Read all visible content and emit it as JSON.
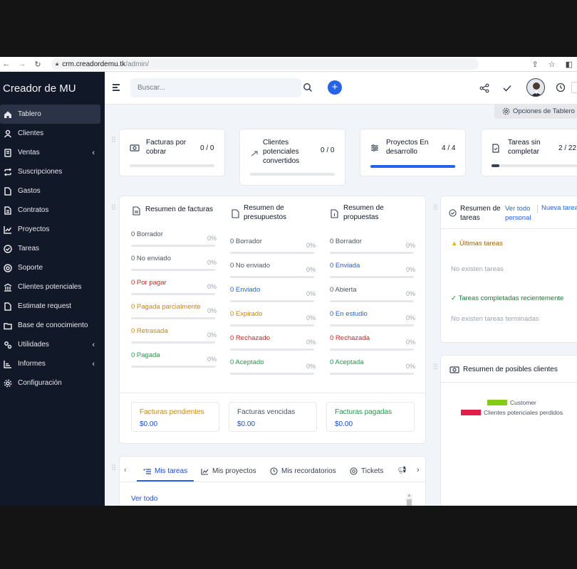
{
  "browser": {
    "url_host": "crm.creadordemu.tk",
    "url_path": "/admin/"
  },
  "sidebar": {
    "brand": "Creador de MU",
    "items": [
      {
        "label": "Tablero",
        "icon": "home-icon",
        "active": true
      },
      {
        "label": "Clientes",
        "icon": "user-icon"
      },
      {
        "label": "Ventas",
        "icon": "receipt-icon",
        "chevron": true
      },
      {
        "label": "Suscripciones",
        "icon": "repeat-icon"
      },
      {
        "label": "Gastos",
        "icon": "document-icon"
      },
      {
        "label": "Contratos",
        "icon": "contract-icon"
      },
      {
        "label": "Proyectos",
        "icon": "chart-icon"
      },
      {
        "label": "Tareas",
        "icon": "check-circle-icon"
      },
      {
        "label": "Soporte",
        "icon": "lifebuoy-icon"
      },
      {
        "label": "Clientes potenciales",
        "icon": "leads-icon"
      },
      {
        "label": "Estimate request",
        "icon": "document-icon"
      },
      {
        "label": "Base de conocimiento",
        "icon": "folder-icon"
      },
      {
        "label": "Utilidades",
        "icon": "gears-icon",
        "chevron": true
      },
      {
        "label": "Informes",
        "icon": "chart-line-icon",
        "chevron": true
      },
      {
        "label": "Configuración",
        "icon": "gear-icon"
      }
    ]
  },
  "topbar": {
    "search_placeholder": "Buscar...",
    "plus": "+"
  },
  "options": {
    "label": "Opciones de Tablero"
  },
  "stats": [
    {
      "title_1": "Facturas por",
      "title_2": "cobrar",
      "title_3": "",
      "value": "0 / 0",
      "progress": 0
    },
    {
      "title_1": "Clientes",
      "title_2": "potenciales",
      "title_3": "convertidos",
      "value": "0 / 0",
      "progress": 0
    },
    {
      "title_1": "Proyectos En",
      "title_2": "desarrollo",
      "title_3": "",
      "value": "4 / 4",
      "progress": 1
    },
    {
      "title_1": "Tareas sin",
      "title_2": "completar",
      "title_3": "",
      "value": "2 / 22",
      "progress": 0.09
    }
  ],
  "resumen": {
    "facturas": {
      "title": "Resumen de facturas",
      "rows": [
        {
          "label": "0 Borrador",
          "pct": "0%",
          "color": "gray"
        },
        {
          "label": "0 No enviado",
          "pct": "0%",
          "color": "gray"
        },
        {
          "label": "0 Por pagar",
          "pct": "0%",
          "color": "red"
        },
        {
          "label": "0 Pagada parcialmente",
          "pct": "0%",
          "color": "orange"
        },
        {
          "label": "0 Retrasada",
          "pct": "0%",
          "color": "orange"
        },
        {
          "label": "0 Pagada",
          "pct": "0%",
          "color": "green"
        }
      ]
    },
    "presupuestos": {
      "title_1": "Resumen de",
      "title_2": "presupuestos",
      "rows": [
        {
          "label": "0 Borrador",
          "pct": "0%",
          "color": "gray"
        },
        {
          "label": "0 No enviado",
          "pct": "0%",
          "color": "gray"
        },
        {
          "label": "0 Enviado",
          "pct": "0%",
          "color": "blue"
        },
        {
          "label": "0 Expirado",
          "pct": "0%",
          "color": "orange"
        },
        {
          "label": "0 Rechazado",
          "pct": "0%",
          "color": "red"
        },
        {
          "label": "0 Aceptado",
          "pct": "0%",
          "color": "green"
        }
      ]
    },
    "propuestas": {
      "title_1": "Resumen de",
      "title_2": "propuestas",
      "rows": [
        {
          "label": "0 Borrador",
          "pct": "0%",
          "color": "gray"
        },
        {
          "label": "0 Enviada",
          "pct": "0%",
          "color": "blue"
        },
        {
          "label": "0 Abierta",
          "pct": "0%",
          "color": "gray"
        },
        {
          "label": "0 En estudio",
          "pct": "0%",
          "color": "blue"
        },
        {
          "label": "0 Rechazada",
          "pct": "0%",
          "color": "red"
        },
        {
          "label": "0 Aceptada",
          "pct": "0%",
          "color": "green"
        }
      ]
    },
    "totals": [
      {
        "title": "Facturas pendientes",
        "value": "$0.00",
        "color": "orange"
      },
      {
        "title": "Facturas vencidas",
        "value": "$0.00",
        "color": "gray"
      },
      {
        "title": "Facturas pagadas",
        "value": "$0.00",
        "color": "green"
      }
    ]
  },
  "tasks": {
    "title_1": "Resumen de",
    "title_2": "tareas",
    "link_all_1": "Ver todo",
    "link_all_2": "personal",
    "link_new": "Nueva tarea",
    "ultimas": "Últimas tareas",
    "no_tasks": "No existen tareas",
    "completed": "Tareas completadas recientemente",
    "no_completed": "No existen tareas terminadas"
  },
  "leads": {
    "title": "Resumen de posibles clientes",
    "legend": [
      {
        "label": "Customer",
        "color": "#84cc16"
      },
      {
        "label": "Clientes potenciales perdidos",
        "color": "#e11d48"
      }
    ]
  },
  "bottom_tabs": {
    "tabs": [
      "Mis tareas",
      "Mis proyectos",
      "Mis recordatorios",
      "Tickets"
    ],
    "ver_todo": "Ver todo"
  }
}
